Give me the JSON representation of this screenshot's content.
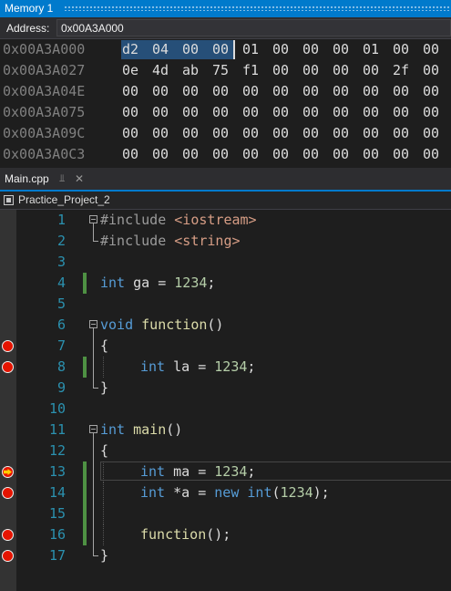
{
  "memory_window": {
    "title": "Memory 1",
    "address_label": "Address:",
    "address_value": "0x00A3A000",
    "rows": [
      {
        "address": "0x00A3A000",
        "bytes": [
          "d2",
          "04",
          "00",
          "00",
          "01",
          "00",
          "00",
          "00",
          "01",
          "00",
          "00"
        ]
      },
      {
        "address": "0x00A3A027",
        "bytes": [
          "0e",
          "4d",
          "ab",
          "75",
          "f1",
          "00",
          "00",
          "00",
          "00",
          "2f",
          "00"
        ]
      },
      {
        "address": "0x00A3A04E",
        "bytes": [
          "00",
          "00",
          "00",
          "00",
          "00",
          "00",
          "00",
          "00",
          "00",
          "00",
          "00"
        ]
      },
      {
        "address": "0x00A3A075",
        "bytes": [
          "00",
          "00",
          "00",
          "00",
          "00",
          "00",
          "00",
          "00",
          "00",
          "00",
          "00"
        ]
      },
      {
        "address": "0x00A3A09C",
        "bytes": [
          "00",
          "00",
          "00",
          "00",
          "00",
          "00",
          "00",
          "00",
          "00",
          "00",
          "00"
        ]
      },
      {
        "address": "0x00A3A0C3",
        "bytes": [
          "00",
          "00",
          "00",
          "00",
          "00",
          "00",
          "00",
          "00",
          "00",
          "00",
          "00"
        ]
      }
    ]
  },
  "editor_tab": {
    "label": "Main.cpp"
  },
  "nav_bar": {
    "project": "Practice_Project_2"
  },
  "code_lines": [
    {
      "n": "1",
      "bp": "none",
      "t": [
        [
          "pp",
          "#include "
        ],
        [
          "str",
          "<iostream>"
        ]
      ]
    },
    {
      "n": "2",
      "bp": "none",
      "t": [
        [
          "pp",
          "#include "
        ],
        [
          "str",
          "<string>"
        ]
      ]
    },
    {
      "n": "3",
      "bp": "none",
      "t": []
    },
    {
      "n": "4",
      "bp": "none",
      "t": [
        [
          "kw",
          "int"
        ],
        [
          "p",
          " ga = "
        ],
        [
          "num",
          "1234"
        ],
        [
          "p",
          ";"
        ]
      ]
    },
    {
      "n": "5",
      "bp": "none",
      "t": []
    },
    {
      "n": "6",
      "bp": "none",
      "t": [
        [
          "kw",
          "void"
        ],
        [
          "p",
          " "
        ],
        [
          "fn",
          "function"
        ],
        [
          "p",
          "()"
        ]
      ]
    },
    {
      "n": "7",
      "bp": "bp",
      "t": [
        [
          "p",
          "{"
        ]
      ]
    },
    {
      "n": "8",
      "bp": "bp",
      "t": [
        [
          "kw",
          "int"
        ],
        [
          "p",
          " la = "
        ],
        [
          "num",
          "1234"
        ],
        [
          "p",
          ";"
        ]
      ]
    },
    {
      "n": "9",
      "bp": "none",
      "t": [
        [
          "p",
          "}"
        ]
      ]
    },
    {
      "n": "10",
      "bp": "none",
      "t": []
    },
    {
      "n": "11",
      "bp": "none",
      "t": [
        [
          "kw",
          "int"
        ],
        [
          "p",
          " "
        ],
        [
          "fn",
          "main"
        ],
        [
          "p",
          "()"
        ]
      ]
    },
    {
      "n": "12",
      "bp": "none",
      "t": [
        [
          "p",
          "{"
        ]
      ]
    },
    {
      "n": "13",
      "bp": "current",
      "t": [
        [
          "kw",
          "int"
        ],
        [
          "p",
          " ma = "
        ],
        [
          "num",
          "1234"
        ],
        [
          "p",
          ";"
        ]
      ]
    },
    {
      "n": "14",
      "bp": "bp",
      "t": [
        [
          "kw",
          "int"
        ],
        [
          "p",
          " *a = "
        ],
        [
          "kw",
          "new"
        ],
        [
          "p",
          " "
        ],
        [
          "kw",
          "int"
        ],
        [
          "p",
          "("
        ],
        [
          "num",
          "1234"
        ],
        [
          "p",
          ");"
        ]
      ]
    },
    {
      "n": "15",
      "bp": "none",
      "t": []
    },
    {
      "n": "16",
      "bp": "bp",
      "t": [
        [
          "fn",
          "function"
        ],
        [
          "p",
          "();"
        ]
      ]
    },
    {
      "n": "17",
      "bp": "bp",
      "t": [
        [
          "p",
          "}"
        ]
      ]
    }
  ]
}
